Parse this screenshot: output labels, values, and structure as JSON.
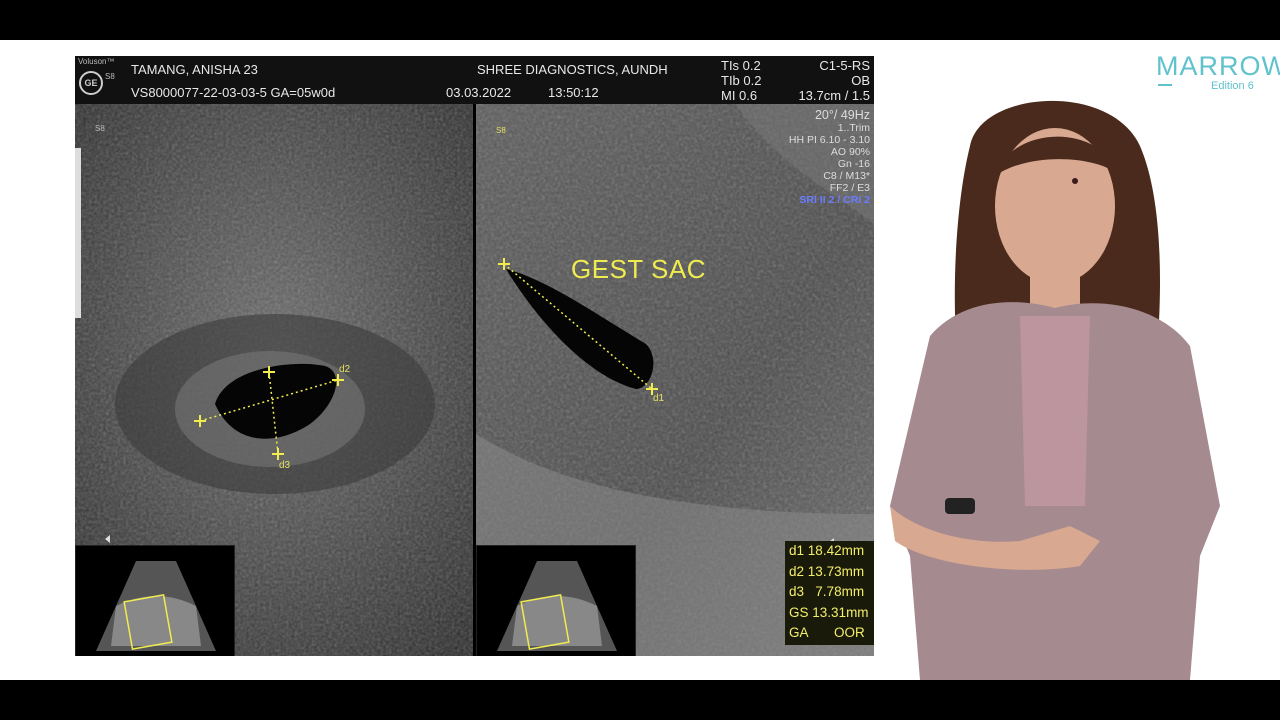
{
  "brand": {
    "name": "MARROW",
    "edition": "Edition 6"
  },
  "scanner": {
    "logo_text": "Voluson™",
    "model": "S8",
    "patient": "TAMANG, ANISHA  23",
    "exam_id": "VS8000077-22-03-03-5  GA=05w0d",
    "clinic": "SHREE DIAGNOSTICS, AUNDH",
    "date": "03.03.2022",
    "time": "13:50:12",
    "tis": "TIs  0.2",
    "tib": "TIb  0.2",
    "mi": "MI   0.6",
    "probe": "C1-5-RS",
    "mode": "OB",
    "depth": "13.7cm / 1.5",
    "angle": "20°/ 49Hz",
    "params": [
      "1..Trim",
      "HH PI 6.10 - 3.10",
      "AO 90%",
      "Gn -16",
      "C8 / M13*",
      "FF2 / E3",
      "SRI II 2 / CRI 2"
    ]
  },
  "annotations": {
    "gest_sac": "GEST SAC",
    "d1": "d1",
    "d2": "d2",
    "d3": "d3"
  },
  "measurements": [
    {
      "label": "d1",
      "value": "18.42mm"
    },
    {
      "label": "d2",
      "value": "13.73mm"
    },
    {
      "label": "d3",
      "value": "7.78mm"
    },
    {
      "label": "GS",
      "value": "13.31mm"
    },
    {
      "label": "GA",
      "value": "OOR"
    }
  ],
  "colors": {
    "brand": "#5fc2cc",
    "caliper": "#f0ec50",
    "highlight_param": "#6a7cff"
  }
}
